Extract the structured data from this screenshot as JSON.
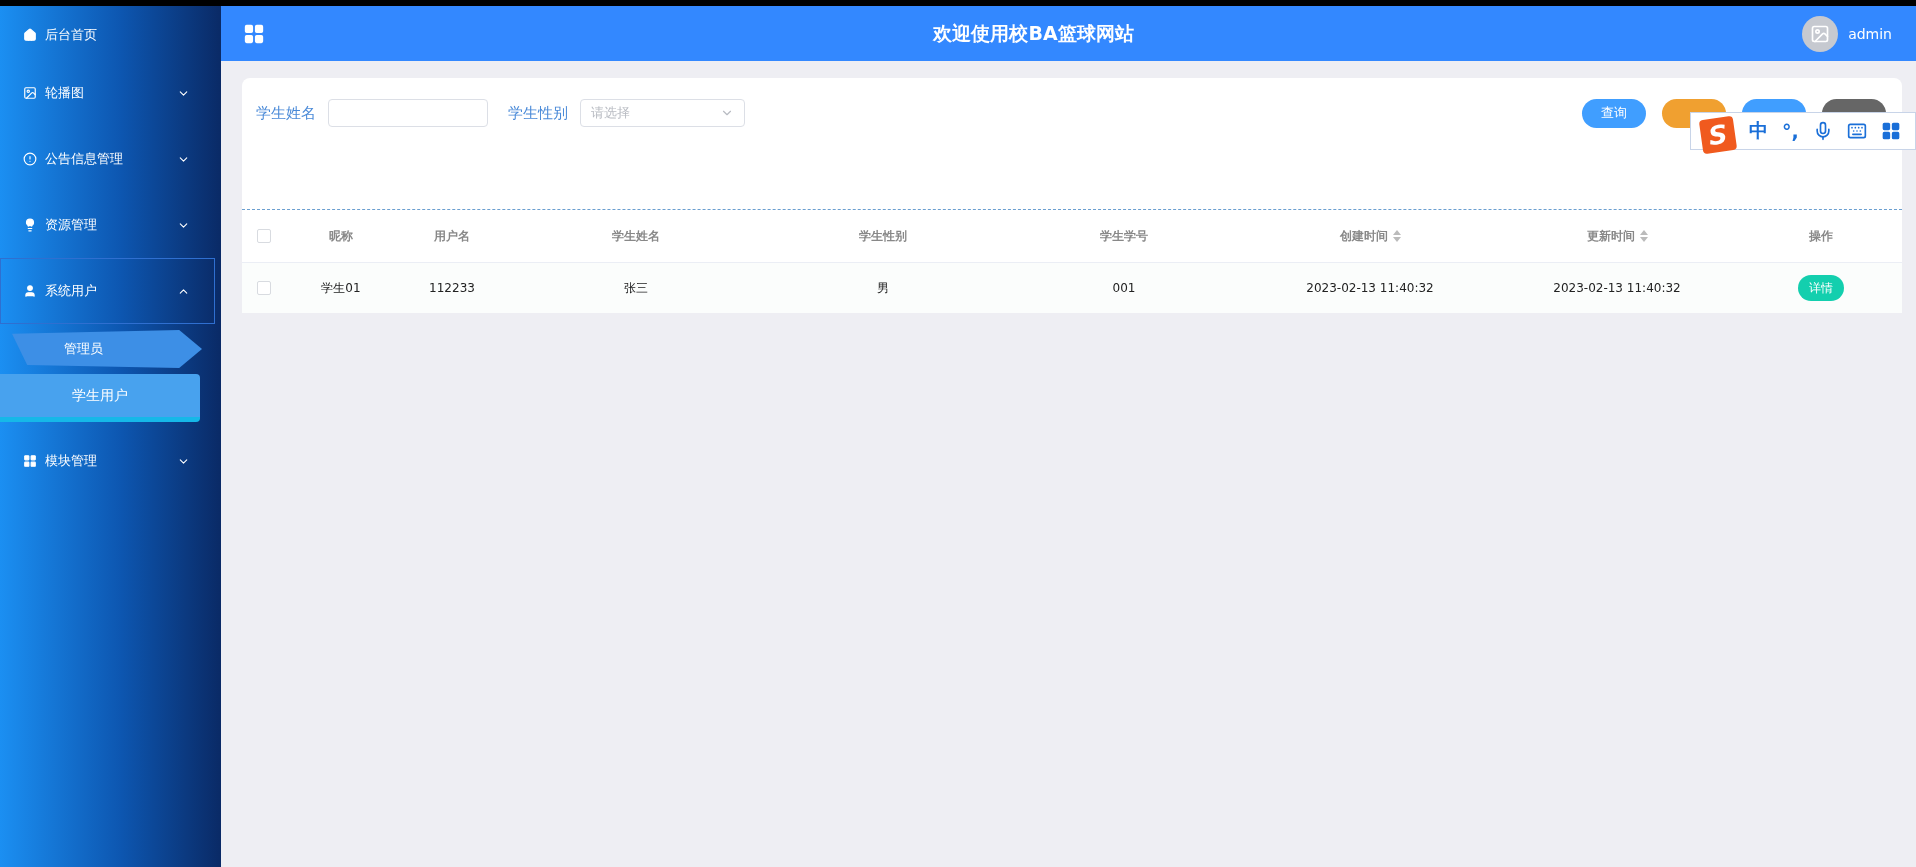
{
  "sidebar": {
    "items": [
      {
        "kind": "link",
        "label": "后台首页"
      },
      {
        "kind": "group",
        "label": "轮播图",
        "expanded": false
      },
      {
        "kind": "group",
        "label": "公告信息管理",
        "expanded": false
      },
      {
        "kind": "group",
        "label": "资源管理",
        "expanded": false
      },
      {
        "kind": "group",
        "label": "系统用户",
        "expanded": true,
        "children": [
          {
            "label": "管理员",
            "selected": false
          },
          {
            "label": "学生用户",
            "selected": true
          }
        ]
      },
      {
        "kind": "group",
        "label": "模块管理",
        "expanded": false
      }
    ]
  },
  "header": {
    "title": "欢迎使用校BA篮球网站",
    "user": "admin"
  },
  "search": {
    "fields": [
      {
        "kind": "text",
        "label": "学生姓名"
      },
      {
        "kind": "select",
        "label": "学生性别",
        "placeholder": "请选择"
      }
    ],
    "buttons": [
      {
        "kind": "primary",
        "label": "查询"
      },
      {
        "kind": "warning"
      },
      {
        "kind": "primary"
      },
      {
        "kind": "dark"
      }
    ]
  },
  "table": {
    "columns": [
      {
        "label": "昵称",
        "sortable": false
      },
      {
        "label": "用户名",
        "sortable": false
      },
      {
        "label": "学生姓名",
        "sortable": false
      },
      {
        "label": "学生性别",
        "sortable": false
      },
      {
        "label": "学生学号",
        "sortable": false
      },
      {
        "label": "创建时间",
        "sortable": true
      },
      {
        "label": "更新时间",
        "sortable": true
      },
      {
        "label": "操作",
        "sortable": false
      }
    ],
    "header_checked": false,
    "rows": [
      {
        "checked": false,
        "cells": [
          "学生01",
          "112233",
          "张三",
          "男",
          "001",
          "2023-02-13 11:40:32",
          "2023-02-13 11:40:32"
        ],
        "action": "详情"
      }
    ]
  },
  "ime_bar": {
    "logo": "S",
    "mode": "中",
    "punctuation": "°,"
  }
}
